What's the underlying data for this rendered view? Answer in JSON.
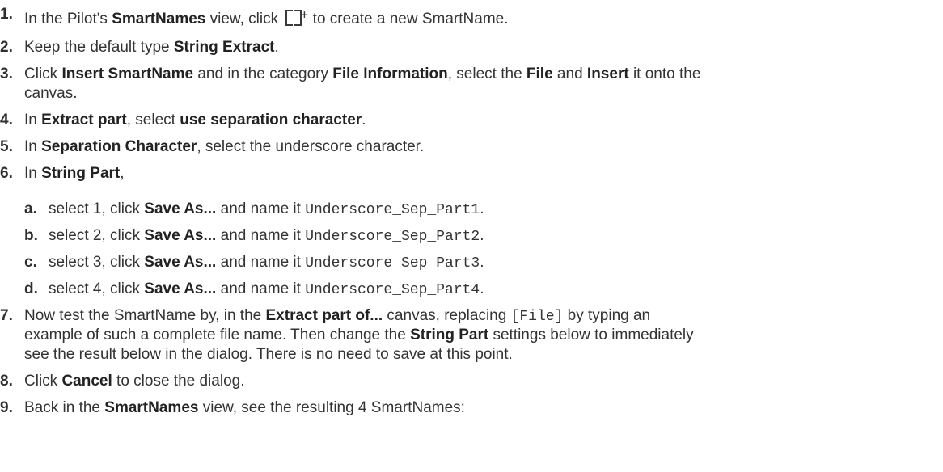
{
  "steps": [
    {
      "num": "1.",
      "a": "In the Pilot's ",
      "b1": "SmartNames",
      "c": " view, click ",
      "icon": "smartname-new-icon",
      "d": " to create a new SmartName."
    },
    {
      "num": "2.",
      "a": "Keep the default type ",
      "b1": "String Extract",
      "c": "."
    },
    {
      "num": "3.",
      "a": "Click ",
      "b1": "Insert SmartName",
      "c": " and in the category ",
      "b2": "File Information",
      "d": ", select the ",
      "b3": "File",
      "e": " and ",
      "b4": "Insert",
      "f": " it onto the",
      "line2": "canvas."
    },
    {
      "num": "4.",
      "a": "In ",
      "b1": "Extract part",
      "c": ", select ",
      "b2": "use separation character",
      "d": "."
    },
    {
      "num": "5.",
      "a": "In ",
      "b1": "Separation Character",
      "c": ", select the underscore character."
    },
    {
      "num": "6.",
      "a": "In ",
      "b1": "String Part",
      "c": ","
    },
    {
      "num": "7.",
      "a": "Now test the SmartName by, in the ",
      "b1": "Extract part of...",
      "c": " canvas, replacing ",
      "code": "[File]",
      "d": " by typing an",
      "line2a": "example of such a complete file name. Then change the ",
      "line2b": "String Part",
      "line2c": " settings below to immediately",
      "line3": "see the result below in the dialog. There is no need to save at this point."
    },
    {
      "num": "8.",
      "a": "Click ",
      "b1": "Cancel",
      "c": " to close the dialog."
    },
    {
      "num": "9.",
      "a": "Back in the ",
      "b1": "SmartNames",
      "c": " view, see the resulting 4 SmartNames:"
    }
  ],
  "substeps": [
    {
      "num": "a.",
      "a": "select 1, click ",
      "b1": "Save As...",
      "c": " and name it ",
      "code": "Underscore_Sep_Part1",
      "d": "."
    },
    {
      "num": "b.",
      "a": "select 2, click ",
      "b1": "Save As...",
      "c": " and name it ",
      "code": "Underscore_Sep_Part2",
      "d": "."
    },
    {
      "num": "c.",
      "a": "select 3, click ",
      "b1": "Save As...",
      "c": " and name it ",
      "code": "Underscore_Sep_Part3",
      "d": "."
    },
    {
      "num": "d.",
      "a": "select 4, click ",
      "b1": "Save As...",
      "c": " and name it ",
      "code": "Underscore_Sep_Part4",
      "d": "."
    }
  ]
}
